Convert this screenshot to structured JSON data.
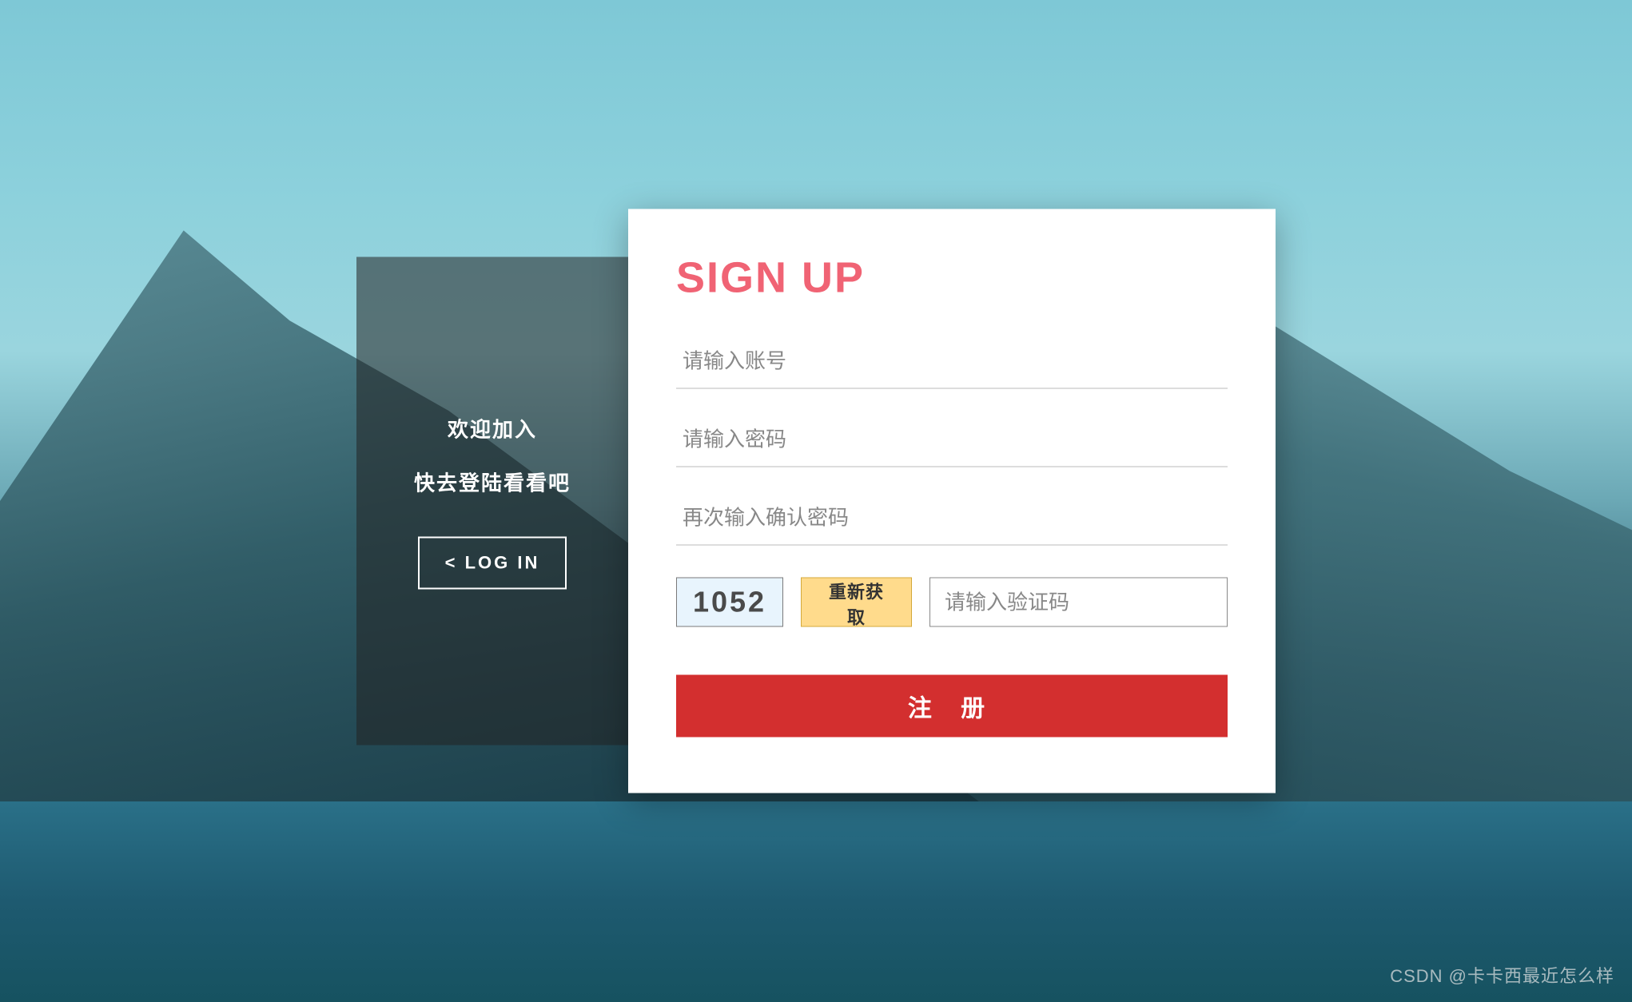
{
  "left_panel": {
    "welcome_title": "欢迎加入",
    "welcome_subtitle": "快去登陆看看吧",
    "login_button_label": "<  LOG IN"
  },
  "signup_panel": {
    "title": "SIGN UP",
    "account_placeholder": "请输入账号",
    "password_placeholder": "请输入密码",
    "confirm_password_placeholder": "再次输入确认密码",
    "captcha_value": "1052",
    "captcha_refresh_label": "重新获取",
    "captcha_input_placeholder": "请输入验证码",
    "submit_label": "注 册"
  },
  "watermark": "CSDN @卡卡西最近怎么样",
  "colors": {
    "accent_title": "#f06374",
    "submit_bg": "#d32f2f",
    "captcha_bg": "#e8f4fd",
    "refresh_bg": "#ffdb8c"
  }
}
